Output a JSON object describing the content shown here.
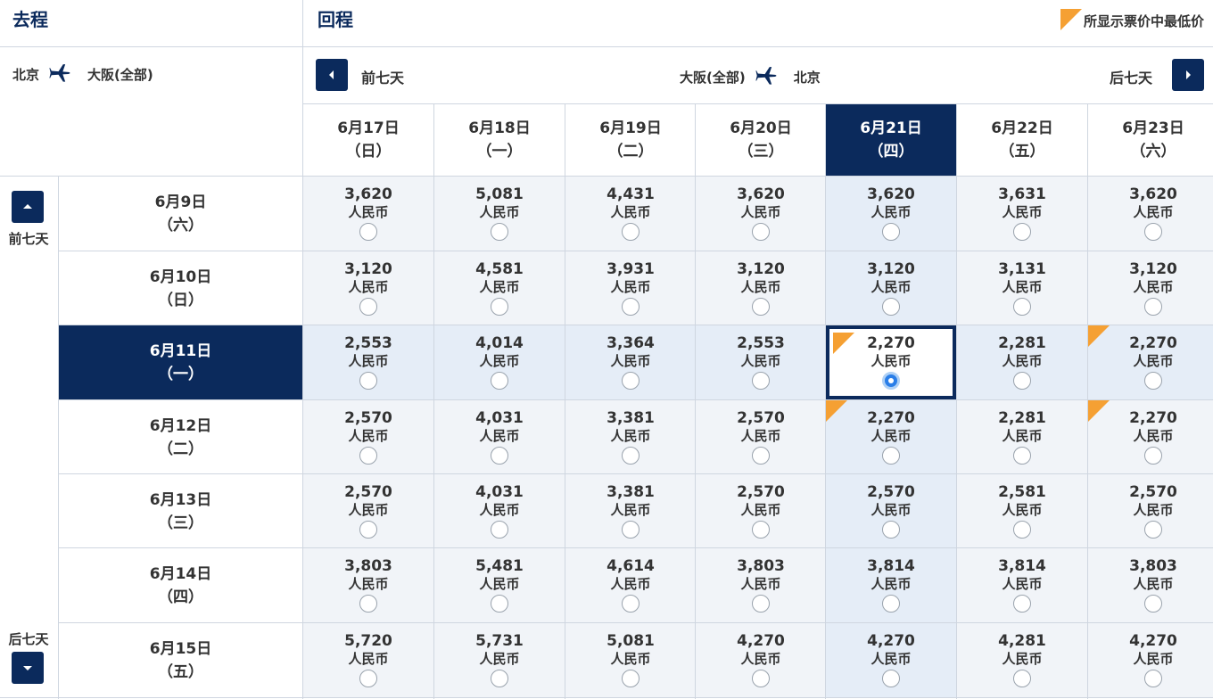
{
  "outbound": {
    "title": "去程",
    "from": "北京",
    "to": "大阪(全部)"
  },
  "inbound": {
    "title": "回程",
    "from": "大阪(全部)",
    "to": "北京"
  },
  "legend": {
    "text": "所显示票价中最低价",
    "color": "#f5a033"
  },
  "nav": {
    "prev_week": "前七天",
    "next_week": "后七天"
  },
  "columns": [
    {
      "date": "6月17日",
      "weekday": "（日）"
    },
    {
      "date": "6月18日",
      "weekday": "（一）"
    },
    {
      "date": "6月19日",
      "weekday": "（二）"
    },
    {
      "date": "6月20日",
      "weekday": "（三）"
    },
    {
      "date": "6月21日",
      "weekday": "（四）"
    },
    {
      "date": "6月22日",
      "weekday": "（五）"
    },
    {
      "date": "6月23日",
      "weekday": "（六）"
    }
  ],
  "rows": [
    {
      "date": "6月9日",
      "weekday": "（六）"
    },
    {
      "date": "6月10日",
      "weekday": "（日）"
    },
    {
      "date": "6月11日",
      "weekday": "（一）"
    },
    {
      "date": "6月12日",
      "weekday": "（二）"
    },
    {
      "date": "6月13日",
      "weekday": "（三）"
    },
    {
      "date": "6月14日",
      "weekday": "（四）"
    },
    {
      "date": "6月15日",
      "weekday": "（五）"
    }
  ],
  "currency": "人民币",
  "prices": [
    [
      "3,620",
      "5,081",
      "4,431",
      "3,620",
      "3,620",
      "3,631",
      "3,620"
    ],
    [
      "3,120",
      "4,581",
      "3,931",
      "3,120",
      "3,120",
      "3,131",
      "3,120"
    ],
    [
      "2,553",
      "4,014",
      "3,364",
      "2,553",
      "2,270",
      "2,281",
      "2,270"
    ],
    [
      "2,570",
      "4,031",
      "3,381",
      "2,570",
      "2,270",
      "2,281",
      "2,270"
    ],
    [
      "2,570",
      "4,031",
      "3,381",
      "2,570",
      "2,570",
      "2,581",
      "2,570"
    ],
    [
      "3,803",
      "5,481",
      "4,614",
      "3,803",
      "3,814",
      "3,814",
      "3,803"
    ],
    [
      "5,720",
      "5,731",
      "5,081",
      "4,270",
      "4,270",
      "4,281",
      "4,270"
    ]
  ],
  "lowest_cells": [
    [
      2,
      4
    ],
    [
      2,
      6
    ],
    [
      3,
      4
    ],
    [
      3,
      6
    ]
  ],
  "selected": {
    "row": 2,
    "col": 4
  },
  "colors": {
    "navy": "#0b2a5c",
    "cell_bg": "#f1f4f8",
    "highlight_bg": "#e5edf7",
    "radio_selected": "#2a7ee8"
  }
}
